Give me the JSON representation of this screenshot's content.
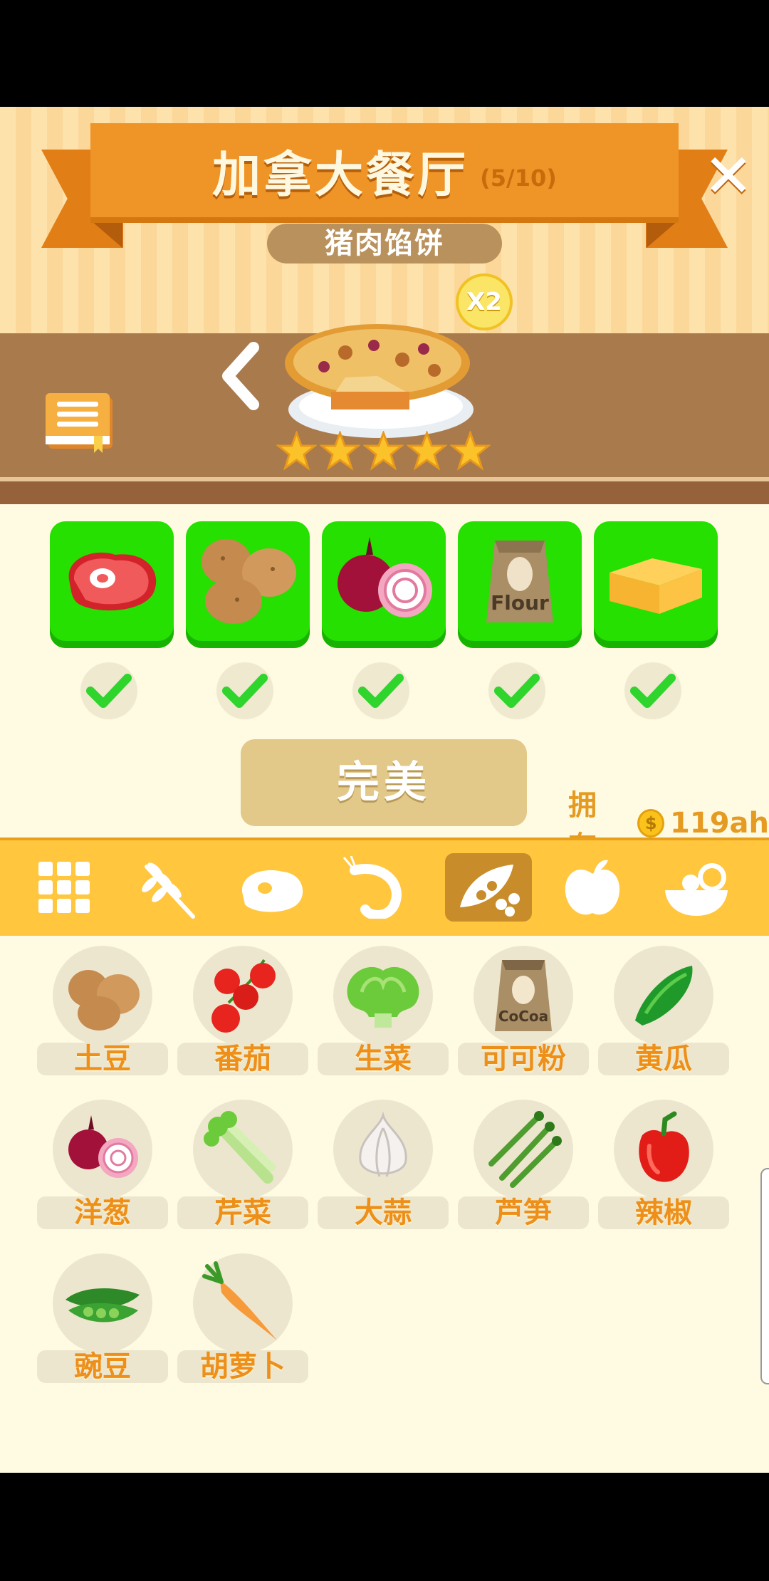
{
  "header": {
    "restaurant_title": "加拿大餐厅",
    "progress": "(5/10)",
    "close_icon": "✕",
    "dish_name": "猪肉馅饼",
    "multiplier": "X2"
  },
  "dish": {
    "icon": "meat-pie",
    "stars": 5,
    "stars_max": 5
  },
  "required_ingredients": [
    {
      "icon": "steak",
      "checked": true
    },
    {
      "icon": "potatoes",
      "checked": true
    },
    {
      "icon": "onion",
      "checked": true
    },
    {
      "icon": "flour-bag",
      "checked": true,
      "print": "Flour"
    },
    {
      "icon": "butter",
      "checked": true
    }
  ],
  "actions": {
    "perfect_label": "完美",
    "owned_label": "拥有:",
    "coin_amount": "119ah"
  },
  "categories": [
    {
      "icon": "grid-all",
      "active": false
    },
    {
      "icon": "wheat",
      "active": false
    },
    {
      "icon": "meat",
      "active": false
    },
    {
      "icon": "shrimp",
      "active": false
    },
    {
      "icon": "peas-vegetable",
      "active": true
    },
    {
      "icon": "apple",
      "active": false
    },
    {
      "icon": "salad-bowl",
      "active": false
    }
  ],
  "ingredients": [
    {
      "label": "土豆",
      "icon": "potato"
    },
    {
      "label": "番茄",
      "icon": "tomato"
    },
    {
      "label": "生菜",
      "icon": "lettuce"
    },
    {
      "label": "可可粉",
      "icon": "cocoa-bag",
      "print": "CoCoa"
    },
    {
      "label": "黄瓜",
      "icon": "cucumber"
    },
    {
      "label": "洋葱",
      "icon": "onion"
    },
    {
      "label": "芹菜",
      "icon": "celery"
    },
    {
      "label": "大蒜",
      "icon": "garlic"
    },
    {
      "label": "芦笋",
      "icon": "asparagus"
    },
    {
      "label": "辣椒",
      "icon": "pepper"
    },
    {
      "label": "豌豆",
      "icon": "peas"
    },
    {
      "label": "胡萝卜",
      "icon": "carrot"
    }
  ],
  "colors": {
    "slot_green": "#25e000",
    "accent_orange": "#ed8f18",
    "category_bar": "#ffc63e",
    "background": "#fffbe3"
  }
}
